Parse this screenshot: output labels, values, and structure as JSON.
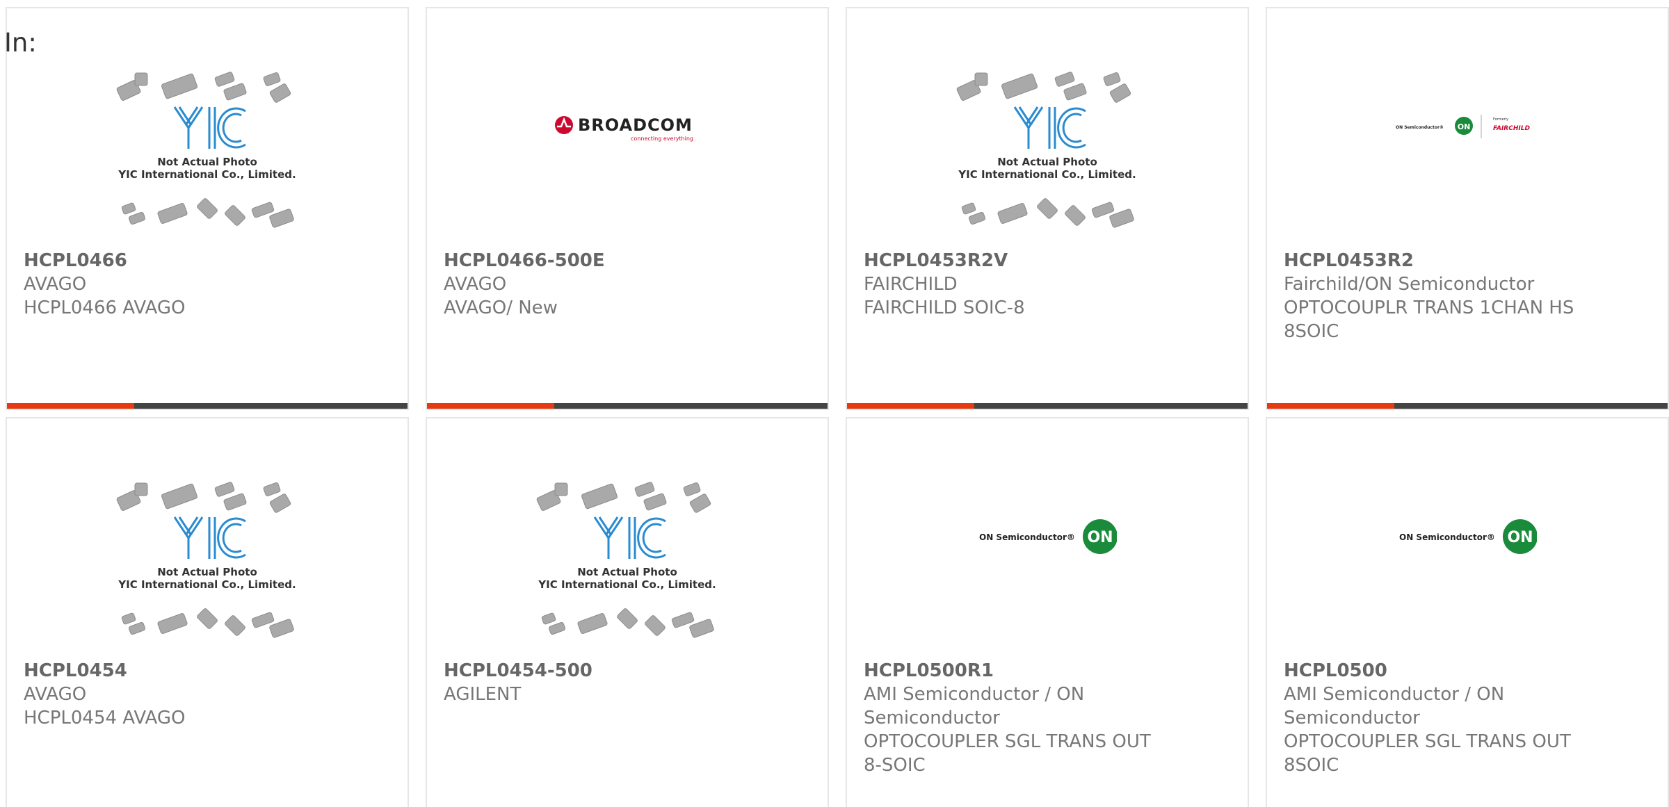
{
  "filter": {
    "label": "In:"
  },
  "colors": {
    "accent": "#e53a12",
    "dark_bar": "#444444",
    "yic_blue": "#2a8bd0",
    "on_green": "#1a8b3a",
    "broadcom_red": "#cc092f"
  },
  "placeholder": {
    "line1": "Not Actual Photo",
    "line2": "YIC International Co., Limited.",
    "logo_text": "YIC"
  },
  "brand_logos": {
    "broadcom": {
      "name": "BROADCOM",
      "tagline": "connecting everything"
    },
    "on": {
      "name": "ON Semiconductor",
      "badge": "ON"
    },
    "on_fairchild": {
      "name": "ON Semiconductor",
      "badge": "ON",
      "formerly": "Formerly",
      "fairchild": "FAIRCHILD"
    }
  },
  "products": [
    {
      "part_number": "HCPL0466",
      "manufacturer": "AVAGO",
      "description": "HCPL0466 AVAGO",
      "image": "placeholder"
    },
    {
      "part_number": "HCPL0466-500E",
      "manufacturer": "AVAGO",
      "description": "AVAGO/ New",
      "image": "broadcom"
    },
    {
      "part_number": "HCPL0453R2V",
      "manufacturer": "FAIRCHILD",
      "description": "FAIRCHILD SOIC-8",
      "image": "placeholder"
    },
    {
      "part_number": "HCPL0453R2",
      "manufacturer": "Fairchild/ON Semiconductor",
      "description": "OPTOCOUPLR TRANS 1CHAN HS 8SOIC",
      "image": "on_fairchild"
    },
    {
      "part_number": "HCPL0454",
      "manufacturer": "AVAGO",
      "description": "HCPL0454 AVAGO",
      "image": "placeholder"
    },
    {
      "part_number": "HCPL0454-500",
      "manufacturer": "AGILENT",
      "description": "",
      "image": "placeholder"
    },
    {
      "part_number": "HCPL0500R1",
      "manufacturer": "AMI Semiconductor / ON Semiconductor",
      "description": "OPTOCOUPLER SGL TRANS OUT 8-SOIC",
      "image": "on"
    },
    {
      "part_number": "HCPL0500",
      "manufacturer": "AMI Semiconductor / ON Semiconductor",
      "description": "OPTOCOUPLER SGL TRANS OUT 8SOIC",
      "image": "on"
    }
  ]
}
